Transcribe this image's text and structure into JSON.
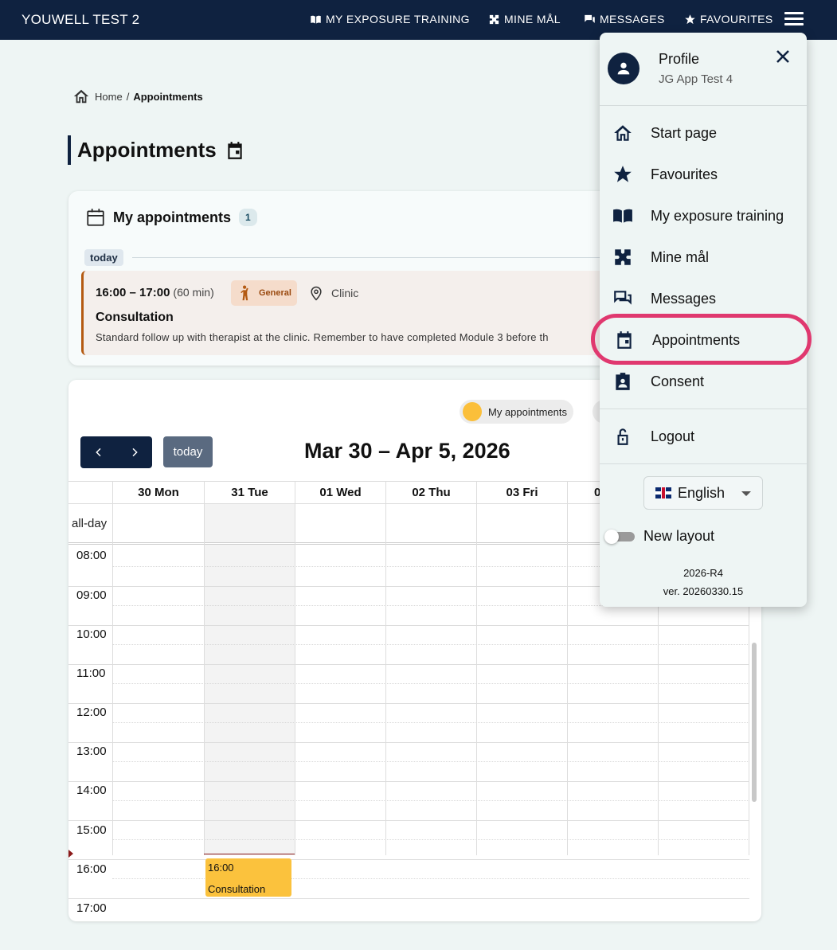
{
  "topbar": {
    "brand": "YOUWELL TEST 2",
    "nav": [
      "MY EXPOSURE TRAINING",
      "MINE MÅL",
      "MESSAGES",
      "FAVOURITES"
    ]
  },
  "breadcrumb": {
    "home": "Home",
    "sep": "/",
    "current": "Appointments"
  },
  "page": {
    "title": "Appointments"
  },
  "appointments_card": {
    "title": "My appointments",
    "count": "1",
    "group": "today",
    "item": {
      "time": "16:00 – 17:00",
      "duration": "(60 min)",
      "category": "General",
      "location": "Clinic",
      "title": "Consultation",
      "description": "Standard follow up with therapist at the clinic. Remember to have completed Module 3 before th"
    }
  },
  "calendar": {
    "legend": "My appointments",
    "today_button": "today",
    "range": "Mar 30 – Apr 5, 2026",
    "days": [
      "30 Mon",
      "31 Tue",
      "01 Wed",
      "02 Thu",
      "03 Fri",
      "0"
    ],
    "allday": "all-day",
    "times": [
      "08:00",
      "09:00",
      "10:00",
      "11:00",
      "12:00",
      "13:00",
      "14:00",
      "15:00",
      "16:00",
      "17:00"
    ],
    "event": {
      "time": "16:00",
      "title": "Consultation",
      "color": "#fbc23d"
    }
  },
  "menu": {
    "profile_name": "Profile",
    "profile_sub": "JG App Test 4",
    "items": [
      "Start page",
      "Favourites",
      "My exposure training",
      "Mine mål",
      "Messages",
      "Appointments",
      "Consent"
    ],
    "logout": "Logout",
    "language": "English",
    "new_layout": "New layout",
    "release": "2026-R4",
    "version": "ver. 20260330.15"
  },
  "colors": {
    "navy": "#0f2240",
    "highlight": "#e0386f",
    "event": "#fbc23d"
  }
}
